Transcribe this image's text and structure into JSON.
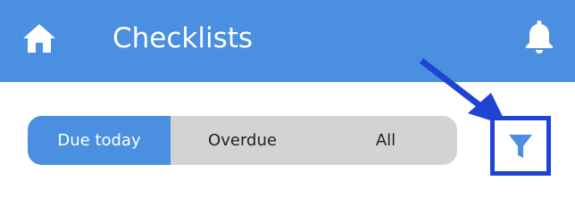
{
  "header": {
    "title": "Checklists",
    "home_icon": "home-icon",
    "bell_icon": "bell-icon"
  },
  "tabs": [
    {
      "label": "Due today",
      "active": true
    },
    {
      "label": "Overdue",
      "active": false
    },
    {
      "label": "All",
      "active": false
    }
  ],
  "filter": {
    "icon": "filter-icon",
    "highlighted": true
  },
  "colors": {
    "header_bg": "#4a8fe0",
    "active_tab_bg": "#4a8fe0",
    "inactive_tab_bg": "#d3d3d3",
    "filter_icon": "#4a8fe0",
    "annotation": "#1f44d4"
  }
}
